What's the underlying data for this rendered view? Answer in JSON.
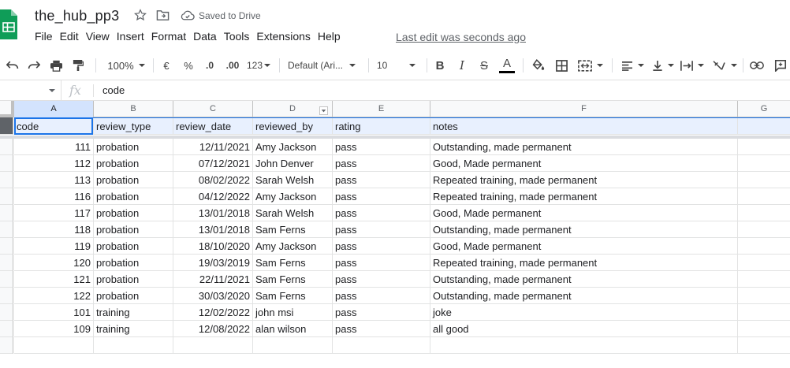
{
  "app": {
    "title": "the_hub_pp3",
    "saved_status": "Saved to Drive",
    "last_edit": "Last edit was seconds ago",
    "menus": [
      "File",
      "Edit",
      "View",
      "Insert",
      "Format",
      "Data",
      "Tools",
      "Extensions",
      "Help"
    ],
    "brand_color": "#0f9d58"
  },
  "toolbar": {
    "zoom": "100%",
    "currency": "€",
    "percent": "%",
    "decrease_decimal": ".0",
    "increase_decimal": ".00",
    "number_format": "123",
    "font": "Default (Ari...",
    "font_size": "10",
    "bold": "B",
    "italic": "I",
    "strikethrough": "S",
    "text_color_label": "A"
  },
  "formula_bar": {
    "cell_ref": "",
    "fx": "fx",
    "content": "code"
  },
  "columns": [
    "A",
    "B",
    "C",
    "D",
    "E",
    "F",
    "G"
  ],
  "header_row": [
    "code",
    "review_type",
    "review_date",
    "reviewed_by",
    "rating",
    "notes"
  ],
  "rows": [
    [
      "111",
      "probation",
      "12/11/2021",
      "Amy Jackson",
      "pass",
      "Outstanding, made permanent"
    ],
    [
      "112",
      "probation",
      "07/12/2021",
      "John Denver",
      "pass",
      "Good, Made permanent"
    ],
    [
      "113",
      "probation",
      "08/02/2022",
      "Sarah Welsh",
      "pass",
      "Repeated training, made permanent"
    ],
    [
      "116",
      "probation",
      "04/12/2022",
      "Amy Jackson",
      "pass",
      "Repeated training, made permanent"
    ],
    [
      "117",
      "probation",
      "13/01/2018",
      "Sarah Welsh",
      "pass",
      "Good, Made permanent"
    ],
    [
      "118",
      "probation",
      "13/01/2018",
      "Sam Ferns",
      "pass",
      "Outstanding, made permanent"
    ],
    [
      "119",
      "probation",
      "18/10/2020",
      "Amy Jackson",
      "pass",
      "Good, Made permanent"
    ],
    [
      "120",
      "probation",
      "19/03/2019",
      "Sam Ferns",
      "pass",
      "Repeated training, made permanent"
    ],
    [
      "121",
      "probation",
      "22/11/2021",
      "Sam Ferns",
      "pass",
      "Outstanding, made permanent"
    ],
    [
      "122",
      "probation",
      "30/03/2020",
      "Sam Ferns",
      "pass",
      "Outstanding, made permanent"
    ],
    [
      "101",
      "training",
      "12/02/2022",
      "john msi",
      "pass",
      "joke"
    ],
    [
      "109",
      "training",
      "12/08/2022",
      "alan wilson",
      "pass",
      "all good"
    ],
    [
      "",
      "",
      "",
      "",
      "",
      ""
    ]
  ],
  "right_aligned": [
    true,
    false,
    true,
    false,
    false,
    false
  ]
}
